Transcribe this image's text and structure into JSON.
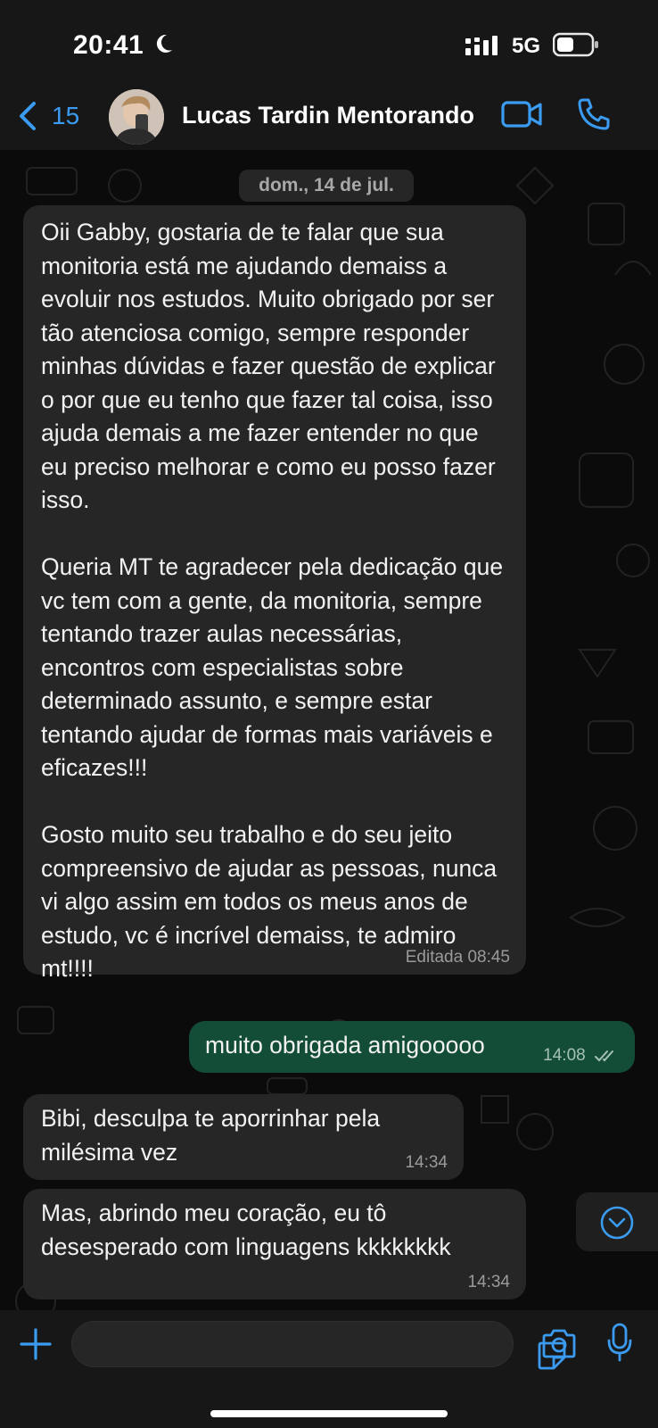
{
  "status_bar": {
    "time": "20:41",
    "network": "5G"
  },
  "header": {
    "back_count": "15",
    "contact_name": "Lucas Tardin Mentorando"
  },
  "chat": {
    "date_label": "dom., 14 de jul.",
    "messages": [
      {
        "direction": "in",
        "text": "Oii Gabby, gostaria de te falar que sua monitoria está me ajudando demaiss a evoluir nos estudos. Muito obrigado por ser tão atenciosa comigo, sempre responder minhas dúvidas e fazer questão de explicar o por que eu tenho que fazer tal coisa, isso ajuda demais a me fazer entender no que eu preciso melhorar e como eu posso fazer isso.\n\nQueria MT te agradecer pela dedicação que vc tem com a gente, da monitoria, sempre tentando trazer aulas necessárias, encontros com especialistas sobre determinado assunto, e sempre estar tentando ajudar de formas mais variáveis e eficazes!!!\n\nGosto muito seu trabalho e do seu jeito compreensivo de ajudar as pessoas, nunca vi algo assim em todos os meus anos de estudo, vc é incrível demaiss, te admiro mt!!!!",
        "meta": "Editada 08:45"
      },
      {
        "direction": "out",
        "text": "muito obrigada amigooooo",
        "meta": "14:08",
        "status": "read"
      },
      {
        "direction": "in",
        "text": "Bibi, desculpa te aporrinhar pela milésima vez",
        "meta": "14:34"
      },
      {
        "direction": "in",
        "text": "Mas, abrindo meu coração, eu tô desesperado com linguagens kkkkkkkk",
        "meta": "14:34"
      }
    ]
  },
  "composer": {
    "placeholder": "",
    "value": ""
  },
  "colors": {
    "accent": "#3b9bf0",
    "incoming_bubble": "#262626",
    "outgoing_bubble": "#144d37",
    "background": "#0b0b0b",
    "bar": "#171717"
  },
  "icons": [
    "moon-icon",
    "signal-icon",
    "battery-icon",
    "back-chevron-icon",
    "video-call-icon",
    "phone-call-icon",
    "double-check-icon",
    "scroll-down-icon",
    "plus-icon",
    "sticker-icon",
    "camera-icon",
    "microphone-icon"
  ]
}
